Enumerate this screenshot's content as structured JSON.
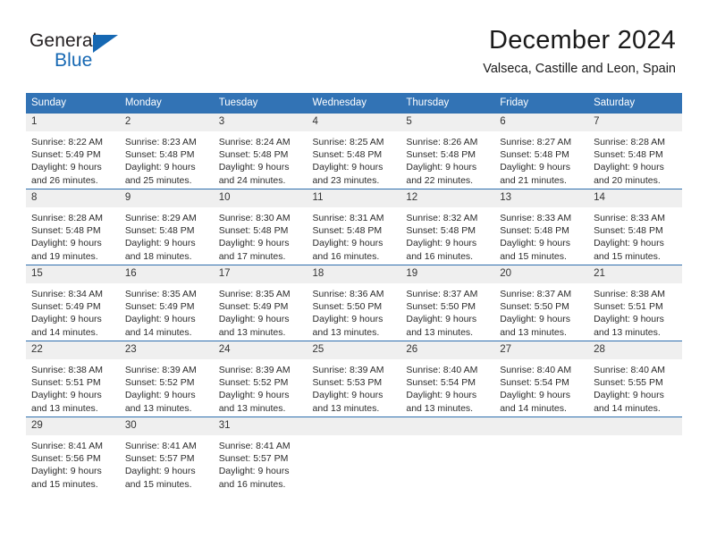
{
  "brand": {
    "name_top": "General",
    "name_bottom": "Blue",
    "accent_color": "#1668b3",
    "text_color": "#231f20"
  },
  "header": {
    "title": "December 2024",
    "subtitle": "Valseca, Castille and Leon, Spain"
  },
  "theme": {
    "header_bg": "#3273b5",
    "header_text": "#ffffff",
    "daynum_bg": "#efefef",
    "cell_bg": "#ffffff",
    "border": "#2f6fae"
  },
  "weekday_headers": [
    "Sunday",
    "Monday",
    "Tuesday",
    "Wednesday",
    "Thursday",
    "Friday",
    "Saturday"
  ],
  "weeks": [
    [
      {
        "day": "1",
        "sunrise": "Sunrise: 8:22 AM",
        "sunset": "Sunset: 5:49 PM",
        "daylight1": "Daylight: 9 hours",
        "daylight2": "and 26 minutes."
      },
      {
        "day": "2",
        "sunrise": "Sunrise: 8:23 AM",
        "sunset": "Sunset: 5:48 PM",
        "daylight1": "Daylight: 9 hours",
        "daylight2": "and 25 minutes."
      },
      {
        "day": "3",
        "sunrise": "Sunrise: 8:24 AM",
        "sunset": "Sunset: 5:48 PM",
        "daylight1": "Daylight: 9 hours",
        "daylight2": "and 24 minutes."
      },
      {
        "day": "4",
        "sunrise": "Sunrise: 8:25 AM",
        "sunset": "Sunset: 5:48 PM",
        "daylight1": "Daylight: 9 hours",
        "daylight2": "and 23 minutes."
      },
      {
        "day": "5",
        "sunrise": "Sunrise: 8:26 AM",
        "sunset": "Sunset: 5:48 PM",
        "daylight1": "Daylight: 9 hours",
        "daylight2": "and 22 minutes."
      },
      {
        "day": "6",
        "sunrise": "Sunrise: 8:27 AM",
        "sunset": "Sunset: 5:48 PM",
        "daylight1": "Daylight: 9 hours",
        "daylight2": "and 21 minutes."
      },
      {
        "day": "7",
        "sunrise": "Sunrise: 8:28 AM",
        "sunset": "Sunset: 5:48 PM",
        "daylight1": "Daylight: 9 hours",
        "daylight2": "and 20 minutes."
      }
    ],
    [
      {
        "day": "8",
        "sunrise": "Sunrise: 8:28 AM",
        "sunset": "Sunset: 5:48 PM",
        "daylight1": "Daylight: 9 hours",
        "daylight2": "and 19 minutes."
      },
      {
        "day": "9",
        "sunrise": "Sunrise: 8:29 AM",
        "sunset": "Sunset: 5:48 PM",
        "daylight1": "Daylight: 9 hours",
        "daylight2": "and 18 minutes."
      },
      {
        "day": "10",
        "sunrise": "Sunrise: 8:30 AM",
        "sunset": "Sunset: 5:48 PM",
        "daylight1": "Daylight: 9 hours",
        "daylight2": "and 17 minutes."
      },
      {
        "day": "11",
        "sunrise": "Sunrise: 8:31 AM",
        "sunset": "Sunset: 5:48 PM",
        "daylight1": "Daylight: 9 hours",
        "daylight2": "and 16 minutes."
      },
      {
        "day": "12",
        "sunrise": "Sunrise: 8:32 AM",
        "sunset": "Sunset: 5:48 PM",
        "daylight1": "Daylight: 9 hours",
        "daylight2": "and 16 minutes."
      },
      {
        "day": "13",
        "sunrise": "Sunrise: 8:33 AM",
        "sunset": "Sunset: 5:48 PM",
        "daylight1": "Daylight: 9 hours",
        "daylight2": "and 15 minutes."
      },
      {
        "day": "14",
        "sunrise": "Sunrise: 8:33 AM",
        "sunset": "Sunset: 5:48 PM",
        "daylight1": "Daylight: 9 hours",
        "daylight2": "and 15 minutes."
      }
    ],
    [
      {
        "day": "15",
        "sunrise": "Sunrise: 8:34 AM",
        "sunset": "Sunset: 5:49 PM",
        "daylight1": "Daylight: 9 hours",
        "daylight2": "and 14 minutes."
      },
      {
        "day": "16",
        "sunrise": "Sunrise: 8:35 AM",
        "sunset": "Sunset: 5:49 PM",
        "daylight1": "Daylight: 9 hours",
        "daylight2": "and 14 minutes."
      },
      {
        "day": "17",
        "sunrise": "Sunrise: 8:35 AM",
        "sunset": "Sunset: 5:49 PM",
        "daylight1": "Daylight: 9 hours",
        "daylight2": "and 13 minutes."
      },
      {
        "day": "18",
        "sunrise": "Sunrise: 8:36 AM",
        "sunset": "Sunset: 5:50 PM",
        "daylight1": "Daylight: 9 hours",
        "daylight2": "and 13 minutes."
      },
      {
        "day": "19",
        "sunrise": "Sunrise: 8:37 AM",
        "sunset": "Sunset: 5:50 PM",
        "daylight1": "Daylight: 9 hours",
        "daylight2": "and 13 minutes."
      },
      {
        "day": "20",
        "sunrise": "Sunrise: 8:37 AM",
        "sunset": "Sunset: 5:50 PM",
        "daylight1": "Daylight: 9 hours",
        "daylight2": "and 13 minutes."
      },
      {
        "day": "21",
        "sunrise": "Sunrise: 8:38 AM",
        "sunset": "Sunset: 5:51 PM",
        "daylight1": "Daylight: 9 hours",
        "daylight2": "and 13 minutes."
      }
    ],
    [
      {
        "day": "22",
        "sunrise": "Sunrise: 8:38 AM",
        "sunset": "Sunset: 5:51 PM",
        "daylight1": "Daylight: 9 hours",
        "daylight2": "and 13 minutes."
      },
      {
        "day": "23",
        "sunrise": "Sunrise: 8:39 AM",
        "sunset": "Sunset: 5:52 PM",
        "daylight1": "Daylight: 9 hours",
        "daylight2": "and 13 minutes."
      },
      {
        "day": "24",
        "sunrise": "Sunrise: 8:39 AM",
        "sunset": "Sunset: 5:52 PM",
        "daylight1": "Daylight: 9 hours",
        "daylight2": "and 13 minutes."
      },
      {
        "day": "25",
        "sunrise": "Sunrise: 8:39 AM",
        "sunset": "Sunset: 5:53 PM",
        "daylight1": "Daylight: 9 hours",
        "daylight2": "and 13 minutes."
      },
      {
        "day": "26",
        "sunrise": "Sunrise: 8:40 AM",
        "sunset": "Sunset: 5:54 PM",
        "daylight1": "Daylight: 9 hours",
        "daylight2": "and 13 minutes."
      },
      {
        "day": "27",
        "sunrise": "Sunrise: 8:40 AM",
        "sunset": "Sunset: 5:54 PM",
        "daylight1": "Daylight: 9 hours",
        "daylight2": "and 14 minutes."
      },
      {
        "day": "28",
        "sunrise": "Sunrise: 8:40 AM",
        "sunset": "Sunset: 5:55 PM",
        "daylight1": "Daylight: 9 hours",
        "daylight2": "and 14 minutes."
      }
    ],
    [
      {
        "day": "29",
        "sunrise": "Sunrise: 8:41 AM",
        "sunset": "Sunset: 5:56 PM",
        "daylight1": "Daylight: 9 hours",
        "daylight2": "and 15 minutes."
      },
      {
        "day": "30",
        "sunrise": "Sunrise: 8:41 AM",
        "sunset": "Sunset: 5:57 PM",
        "daylight1": "Daylight: 9 hours",
        "daylight2": "and 15 minutes."
      },
      {
        "day": "31",
        "sunrise": "Sunrise: 8:41 AM",
        "sunset": "Sunset: 5:57 PM",
        "daylight1": "Daylight: 9 hours",
        "daylight2": "and 16 minutes."
      },
      {
        "day": "",
        "sunrise": "",
        "sunset": "",
        "daylight1": "",
        "daylight2": ""
      },
      {
        "day": "",
        "sunrise": "",
        "sunset": "",
        "daylight1": "",
        "daylight2": ""
      },
      {
        "day": "",
        "sunrise": "",
        "sunset": "",
        "daylight1": "",
        "daylight2": ""
      },
      {
        "day": "",
        "sunrise": "",
        "sunset": "",
        "daylight1": "",
        "daylight2": ""
      }
    ]
  ]
}
